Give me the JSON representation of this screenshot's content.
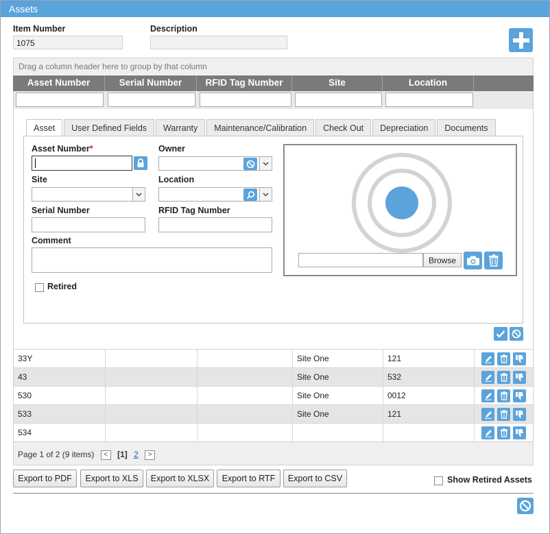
{
  "window": {
    "title": "Assets"
  },
  "header": {
    "item_number_label": "Item Number",
    "item_number_value": "1075",
    "description_label": "Description",
    "description_value": ""
  },
  "grid": {
    "group_hint": "Drag a column header here to group by that column",
    "columns": [
      "Asset Number",
      "Serial Number",
      "RFID Tag Number",
      "Site",
      "Location"
    ],
    "rows": [
      {
        "asset": "33Y",
        "serial": "",
        "rfid": "",
        "site": "Site One",
        "location": "121"
      },
      {
        "asset": "43",
        "serial": "",
        "rfid": "",
        "site": "Site One",
        "location": "532"
      },
      {
        "asset": "530",
        "serial": "",
        "rfid": "",
        "site": "Site One",
        "location": "0012"
      },
      {
        "asset": "533",
        "serial": "",
        "rfid": "",
        "site": "Site One",
        "location": "121"
      },
      {
        "asset": "534",
        "serial": "",
        "rfid": "",
        "site": "",
        "location": ""
      }
    ]
  },
  "tabs": [
    "Asset",
    "User Defined Fields",
    "Warranty",
    "Maintenance/Calibration",
    "Check Out",
    "Depreciation",
    "Documents"
  ],
  "form": {
    "asset_number_label": "Asset Number",
    "required_mark": "*",
    "owner_label": "Owner",
    "site_label": "Site",
    "location_label": "Location",
    "serial_label": "Serial Number",
    "rfid_label": "RFID Tag Number",
    "comment_label": "Comment",
    "retired_label": "Retired",
    "browse_label": "Browse"
  },
  "pager": {
    "summary": "Page 1 of 2 (9 items)",
    "current": "[1]",
    "next_page": "2",
    "prev": "<",
    "next": ">"
  },
  "export": {
    "pdf": "Export to PDF",
    "xls": "Export to XLS",
    "xlsx": "Export to XLSX",
    "rtf": "Export to RTF",
    "csv": "Export to CSV"
  },
  "show_retired_label": "Show Retired Assets",
  "colors": {
    "accent": "#5aa3db",
    "header_bg": "#7a7a7a",
    "alt_row": "#e5e5e5"
  },
  "icons": [
    "plus-icon",
    "lock-icon",
    "clear-icon",
    "search-icon",
    "camera-icon",
    "trash-icon",
    "check-icon",
    "cancel-icon",
    "edit-icon",
    "thumbs-down-icon"
  ]
}
